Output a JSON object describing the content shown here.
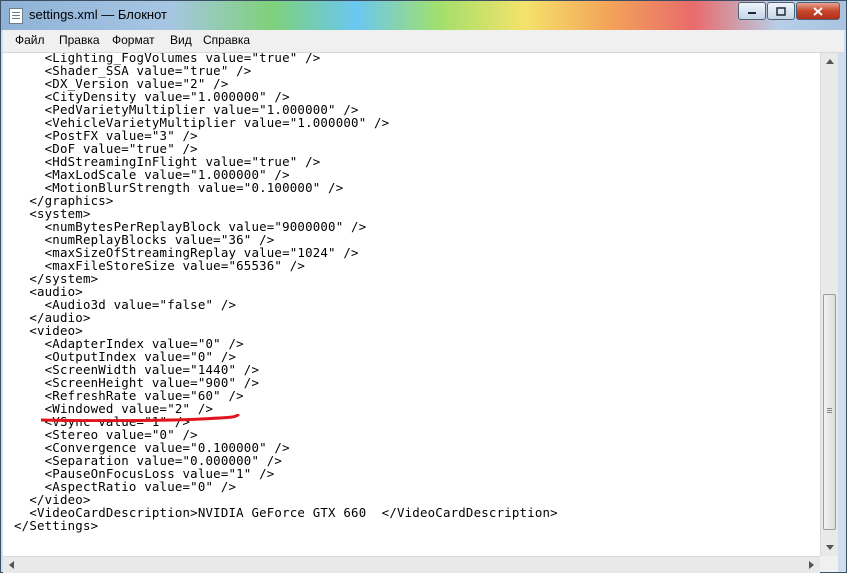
{
  "window": {
    "title": "settings.xml — Блокнот",
    "controls": {
      "minimize_icon": "minimize-icon",
      "maximize_icon": "maximize-icon",
      "close_icon": "close-icon"
    }
  },
  "menu": {
    "items": [
      {
        "label": "Файл"
      },
      {
        "label": "Правка"
      },
      {
        "label": "Формат"
      },
      {
        "label": "Вид"
      },
      {
        "label": "Справка"
      }
    ]
  },
  "editor": {
    "content": "    <Lighting_FogVolumes value=\"true\" />\n    <Shader_SSA value=\"true\" />\n    <DX_Version value=\"2\" />\n    <CityDensity value=\"1.000000\" />\n    <PedVarietyMultiplier value=\"1.000000\" />\n    <VehicleVarietyMultiplier value=\"1.000000\" />\n    <PostFX value=\"3\" />\n    <DoF value=\"true\" />\n    <HdStreamingInFlight value=\"true\" />\n    <MaxLodScale value=\"1.000000\" />\n    <MotionBlurStrength value=\"0.100000\" />\n  </graphics>\n  <system>\n    <numBytesPerReplayBlock value=\"9000000\" />\n    <numReplayBlocks value=\"36\" />\n    <maxSizeOfStreamingReplay value=\"1024\" />\n    <maxFileStoreSize value=\"65536\" />\n  </system>\n  <audio>\n    <Audio3d value=\"false\" />\n  </audio>\n  <video>\n    <AdapterIndex value=\"0\" />\n    <OutputIndex value=\"0\" />\n    <ScreenWidth value=\"1440\" />\n    <ScreenHeight value=\"900\" />\n    <RefreshRate value=\"60\" />\n    <Windowed value=\"2\" />\n    <VSync value=\"1\" />\n    <Stereo value=\"0\" />\n    <Convergence value=\"0.100000\" />\n    <Separation value=\"0.000000\" />\n    <PauseOnFocusLoss value=\"1\" />\n    <AspectRatio value=\"0\" />\n  </video>\n  <VideoCardDescription>NVIDIA GeForce GTX 660  </VideoCardDescription>\n</Settings>",
    "annotation_color": "#e0141e"
  },
  "scrollbars": {
    "vertical_up_icon": "arrow-up-icon",
    "vertical_down_icon": "arrow-down-icon",
    "horizontal_left_icon": "arrow-left-icon",
    "horizontal_right_icon": "arrow-right-icon"
  }
}
